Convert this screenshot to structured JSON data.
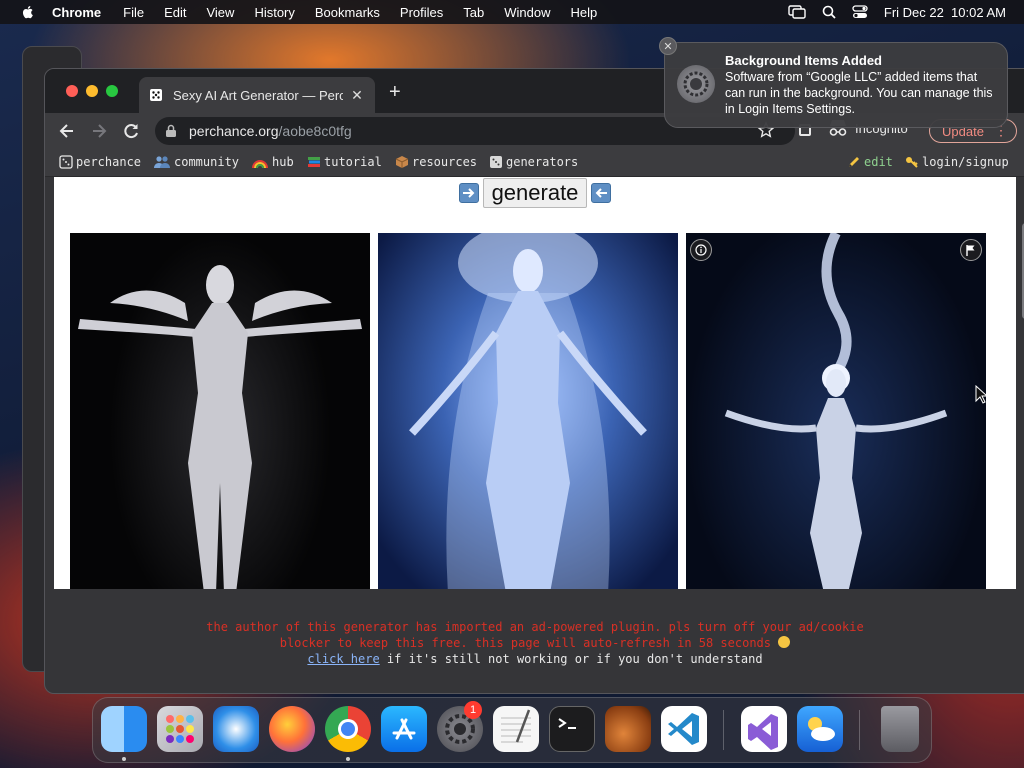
{
  "menubar": {
    "app_name": "Chrome",
    "items": [
      "File",
      "Edit",
      "View",
      "History",
      "Bookmarks",
      "Profiles",
      "Tab",
      "Window",
      "Help"
    ],
    "clock": "Fri Dec 22  10:02 AM"
  },
  "browser": {
    "tab_title": "Sexy AI Art Generator — Perchance AI",
    "url_host": "perchance.org",
    "url_path": "/aobe8c0tfg",
    "incognito_label": "Incognito",
    "update_label": "Update"
  },
  "bookmarks": {
    "items": [
      "perchance",
      "community",
      "hub",
      "tutorial",
      "resources",
      "generators"
    ],
    "edit_label": "edit",
    "login_label": "login/signup"
  },
  "page": {
    "generate_label": "generate",
    "notice_line1": "the author of this generator has imported an ad-powered plugin. pls turn off your ad/cookie",
    "notice_line2": "blocker to keep this free. this page will auto-refresh in 58 seconds",
    "notice_link": "click here",
    "notice_rest": " if it's still not working or if you don't understand"
  },
  "notification": {
    "title": "Background Items Added",
    "body": "Software from “Google LLC” added items that can run in the background. You can manage this in Login Items Settings."
  },
  "dock": {
    "badge_count": "1"
  },
  "colors": {
    "update_accent": "#f28b82",
    "notice_warning": "#d93025",
    "link": "#8ab4f8",
    "edit_green": "#8fd18f"
  }
}
